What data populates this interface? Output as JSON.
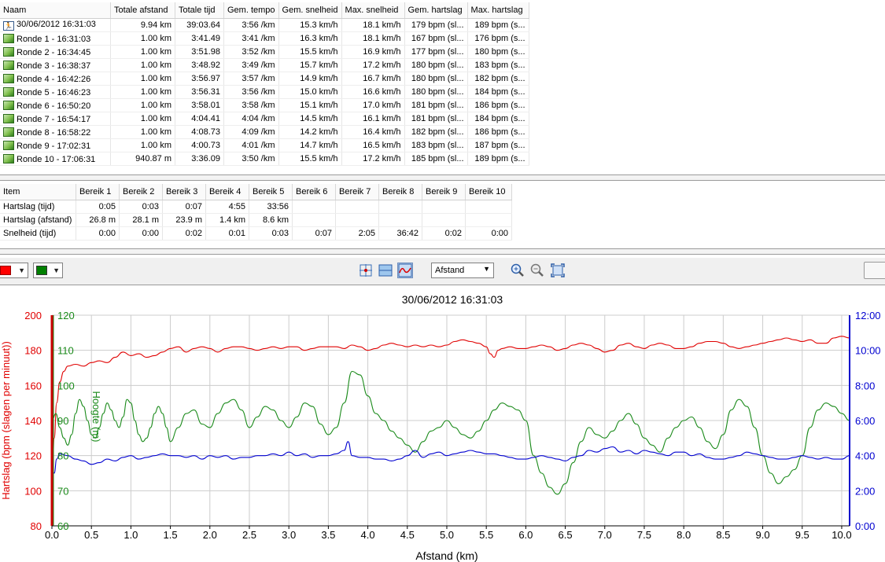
{
  "laps": {
    "columns": [
      "Naam",
      "Totale afstand",
      "Totale tijd",
      "Gem. tempo",
      "Gem. snelheid",
      "Max. snelheid",
      "Gem. hartslag",
      "Max. hartslag"
    ],
    "rows": [
      {
        "name": "30/06/2012 16:31:03",
        "icon": "run-icon",
        "dist": "9.94 km",
        "time": "39:03.64",
        "pace": "3:56 /km",
        "avg_speed": "15.3 km/h",
        "max_speed": "18.1 km/h",
        "avg_hr": "179 bpm (sl...",
        "max_hr": "189 bpm (s..."
      },
      {
        "name": "Ronde 1 - 16:31:03",
        "icon": "lap-icon",
        "dist": "1.00 km",
        "time": "3:41.49",
        "pace": "3:41 /km",
        "avg_speed": "16.3 km/h",
        "max_speed": "18.1 km/h",
        "avg_hr": "167 bpm (sl...",
        "max_hr": "176 bpm (s..."
      },
      {
        "name": "Ronde 2 - 16:34:45",
        "icon": "lap-icon",
        "dist": "1.00 km",
        "time": "3:51.98",
        "pace": "3:52 /km",
        "avg_speed": "15.5 km/h",
        "max_speed": "16.9 km/h",
        "avg_hr": "177 bpm (sl...",
        "max_hr": "180 bpm (s..."
      },
      {
        "name": "Ronde 3 - 16:38:37",
        "icon": "lap-icon",
        "dist": "1.00 km",
        "time": "3:48.92",
        "pace": "3:49 /km",
        "avg_speed": "15.7 km/h",
        "max_speed": "17.2 km/h",
        "avg_hr": "180 bpm (sl...",
        "max_hr": "183 bpm (s..."
      },
      {
        "name": "Ronde 4 - 16:42:26",
        "icon": "lap-icon",
        "dist": "1.00 km",
        "time": "3:56.97",
        "pace": "3:57 /km",
        "avg_speed": "14.9 km/h",
        "max_speed": "16.7 km/h",
        "avg_hr": "180 bpm (sl...",
        "max_hr": "182 bpm (s..."
      },
      {
        "name": "Ronde 5 - 16:46:23",
        "icon": "lap-icon",
        "dist": "1.00 km",
        "time": "3:56.31",
        "pace": "3:56 /km",
        "avg_speed": "15.0 km/h",
        "max_speed": "16.6 km/h",
        "avg_hr": "180 bpm (sl...",
        "max_hr": "184 bpm (s..."
      },
      {
        "name": "Ronde 6 - 16:50:20",
        "icon": "lap-icon",
        "dist": "1.00 km",
        "time": "3:58.01",
        "pace": "3:58 /km",
        "avg_speed": "15.1 km/h",
        "max_speed": "17.0 km/h",
        "avg_hr": "181 bpm (sl...",
        "max_hr": "186 bpm (s..."
      },
      {
        "name": "Ronde 7 - 16:54:17",
        "icon": "lap-icon",
        "dist": "1.00 km",
        "time": "4:04.41",
        "pace": "4:04 /km",
        "avg_speed": "14.5 km/h",
        "max_speed": "16.1 km/h",
        "avg_hr": "181 bpm (sl...",
        "max_hr": "184 bpm (s..."
      },
      {
        "name": "Ronde 8 - 16:58:22",
        "icon": "lap-icon",
        "dist": "1.00 km",
        "time": "4:08.73",
        "pace": "4:09 /km",
        "avg_speed": "14.2 km/h",
        "max_speed": "16.4 km/h",
        "avg_hr": "182 bpm (sl...",
        "max_hr": "186 bpm (s..."
      },
      {
        "name": "Ronde 9 - 17:02:31",
        "icon": "lap-icon",
        "dist": "1.00 km",
        "time": "4:00.73",
        "pace": "4:01 /km",
        "avg_speed": "14.7 km/h",
        "max_speed": "16.5 km/h",
        "avg_hr": "183 bpm (sl...",
        "max_hr": "187 bpm (s..."
      },
      {
        "name": "Ronde 10 - 17:06:31",
        "icon": "lap-icon",
        "dist": "940.87 m",
        "time": "3:36.09",
        "pace": "3:50 /km",
        "avg_speed": "15.5 km/h",
        "max_speed": "17.2 km/h",
        "avg_hr": "185 bpm (sl...",
        "max_hr": "189 bpm (s..."
      }
    ]
  },
  "zones": {
    "columns": [
      "Item",
      "Bereik 1",
      "Bereik 2",
      "Bereik 3",
      "Bereik 4",
      "Bereik 5",
      "Bereik 6",
      "Bereik 7",
      "Bereik 8",
      "Bereik 9",
      "Bereik 10"
    ],
    "rows": [
      {
        "label": "Hartslag (tijd)",
        "values": [
          "0:05",
          "0:03",
          "0:07",
          "4:55",
          "33:56",
          "",
          "",
          "",
          "",
          ""
        ]
      },
      {
        "label": "Hartslag (afstand)",
        "values": [
          "26.8 m",
          "28.1 m",
          "23.9 m",
          "1.4 km",
          "8.6 km",
          "",
          "",
          "",
          "",
          ""
        ]
      },
      {
        "label": "Snelheid (tijd)",
        "values": [
          "0:00",
          "0:00",
          "0:02",
          "0:01",
          "0:03",
          "0:07",
          "2:05",
          "36:42",
          "0:02",
          "0:00"
        ]
      }
    ]
  },
  "toolbar": {
    "color1": "#ff0000",
    "color2": "#008000",
    "x_axis_select": "Afstand"
  },
  "chart_data": {
    "type": "line",
    "title": "30/06/2012 16:31:03",
    "xlabel": "Afstand (km)",
    "xlim": [
      0,
      10.1
    ],
    "x_ticks": [
      "0.0",
      "0.5",
      "1.0",
      "1.5",
      "2.0",
      "2.5",
      "3.0",
      "3.5",
      "4.0",
      "4.5",
      "5.0",
      "5.5",
      "6.0",
      "6.5",
      "7.0",
      "7.5",
      "8.0",
      "8.5",
      "9.0",
      "9.5",
      "10.0"
    ],
    "grid": true,
    "axes": {
      "hr": {
        "label": "Hartslag (bpm (slagen per minuut))",
        "ylim": [
          80,
          200
        ],
        "ticks": [
          "80",
          "100",
          "120",
          "140",
          "160",
          "180",
          "200"
        ],
        "color": "#e00000"
      },
      "alt": {
        "label": "Hoogte (m)",
        "ylim": [
          60,
          120
        ],
        "ticks": [
          "60",
          "70",
          "80",
          "90",
          "100",
          "110",
          "120"
        ],
        "color": "#1a8a1a"
      },
      "speed": {
        "label": "",
        "ylim": [
          0,
          12
        ],
        "ticks": [
          "0:00",
          "2:00",
          "4:00",
          "6:00",
          "8:00",
          "10:00",
          "12:00"
        ],
        "color": "#0000d0"
      }
    },
    "series": [
      {
        "axis": "hr",
        "x": [
          0,
          0.03,
          0.06,
          0.1,
          0.15,
          0.2,
          0.3,
          0.4,
          0.5,
          0.6,
          0.7,
          0.8,
          0.9,
          1.0,
          1.1,
          1.2,
          1.3,
          1.4,
          1.5,
          1.6,
          1.7,
          1.8,
          1.9,
          2.0,
          2.1,
          2.2,
          2.3,
          2.4,
          2.5,
          2.6,
          2.7,
          2.8,
          2.9,
          3.0,
          3.1,
          3.2,
          3.3,
          3.4,
          3.5,
          3.6,
          3.7,
          3.8,
          3.9,
          4.0,
          4.1,
          4.2,
          4.3,
          4.4,
          4.5,
          4.6,
          4.7,
          4.8,
          4.9,
          5.0,
          5.1,
          5.2,
          5.3,
          5.4,
          5.5,
          5.55,
          5.6,
          5.65,
          5.7,
          5.8,
          5.9,
          6.0,
          6.1,
          6.2,
          6.3,
          6.4,
          6.5,
          6.6,
          6.7,
          6.8,
          6.9,
          7.0,
          7.1,
          7.2,
          7.3,
          7.4,
          7.5,
          7.6,
          7.7,
          7.8,
          7.9,
          8.0,
          8.1,
          8.2,
          8.3,
          8.4,
          8.5,
          8.6,
          8.7,
          8.8,
          8.9,
          9.0,
          9.1,
          9.2,
          9.3,
          9.4,
          9.5,
          9.6,
          9.7,
          9.8,
          9.9,
          10.0,
          10.1
        ],
        "y": [
          100,
          130,
          150,
          162,
          168,
          171,
          172,
          171,
          173,
          174,
          173,
          176,
          179,
          177,
          178,
          176,
          177,
          179,
          181,
          182,
          179,
          181,
          182,
          181,
          179,
          181,
          182,
          182,
          181,
          180,
          181,
          182,
          181,
          182,
          182,
          180,
          181,
          182,
          182,
          182,
          181,
          183,
          182,
          180,
          181,
          183,
          184,
          183,
          182,
          183,
          182,
          183,
          182,
          183,
          185,
          186,
          185,
          184,
          182,
          178,
          176,
          180,
          181,
          182,
          181,
          181,
          182,
          183,
          182,
          180,
          181,
          183,
          184,
          183,
          181,
          179,
          180,
          183,
          184,
          182,
          181,
          183,
          184,
          183,
          181,
          181,
          182,
          184,
          185,
          185,
          184,
          182,
          181,
          182,
          183,
          184,
          185,
          186,
          187,
          186,
          185,
          186,
          184,
          184,
          187,
          188,
          187
        ]
      },
      {
        "axis": "alt",
        "x": [
          0,
          0.05,
          0.1,
          0.15,
          0.2,
          0.25,
          0.3,
          0.35,
          0.4,
          0.45,
          0.5,
          0.55,
          0.6,
          0.65,
          0.7,
          0.75,
          0.8,
          0.85,
          0.9,
          0.95,
          1.0,
          1.05,
          1.1,
          1.15,
          1.2,
          1.25,
          1.3,
          1.35,
          1.4,
          1.45,
          1.5,
          1.6,
          1.7,
          1.8,
          1.9,
          2.0,
          2.1,
          2.2,
          2.3,
          2.4,
          2.5,
          2.6,
          2.7,
          2.8,
          2.9,
          3.0,
          3.1,
          3.2,
          3.3,
          3.4,
          3.5,
          3.6,
          3.7,
          3.8,
          3.9,
          4.0,
          4.1,
          4.2,
          4.3,
          4.4,
          4.5,
          4.6,
          4.7,
          4.8,
          4.9,
          5.0,
          5.1,
          5.2,
          5.3,
          5.4,
          5.5,
          5.6,
          5.7,
          5.8,
          5.9,
          6.0,
          6.1,
          6.2,
          6.3,
          6.4,
          6.5,
          6.6,
          6.7,
          6.8,
          6.9,
          7.0,
          7.1,
          7.2,
          7.3,
          7.4,
          7.5,
          7.6,
          7.7,
          7.8,
          7.9,
          8.0,
          8.1,
          8.2,
          8.3,
          8.4,
          8.5,
          8.6,
          8.7,
          8.8,
          8.9,
          9.0,
          9.1,
          9.2,
          9.3,
          9.4,
          9.5,
          9.6,
          9.7,
          9.8,
          9.9,
          10.0,
          10.1
        ],
        "y": [
          90,
          92,
          88,
          85,
          83,
          86,
          92,
          96,
          94,
          90,
          86,
          85,
          88,
          92,
          95,
          93,
          90,
          88,
          91,
          96,
          95,
          90,
          86,
          84,
          85,
          88,
          92,
          94,
          92,
          88,
          84,
          88,
          92,
          93,
          89,
          88,
          92,
          95,
          96,
          93,
          88,
          91,
          94,
          93,
          90,
          88,
          91,
          95,
          94,
          89,
          86,
          88,
          95,
          104,
          103,
          97,
          92,
          90,
          87,
          85,
          83,
          81,
          84,
          87,
          88,
          90,
          88,
          86,
          85,
          87,
          90,
          93,
          95,
          94,
          93,
          90,
          80,
          75,
          71,
          69,
          72,
          78,
          84,
          88,
          86,
          85,
          87,
          90,
          92,
          89,
          85,
          83,
          81,
          85,
          88,
          90,
          91,
          88,
          84,
          82,
          86,
          93,
          96,
          94,
          88,
          80,
          75,
          72,
          74,
          76,
          80,
          88,
          93,
          95,
          94,
          92,
          90
        ]
      },
      {
        "axis": "speed",
        "x": [
          0,
          0.03,
          0.06,
          0.1,
          0.2,
          0.3,
          0.4,
          0.5,
          0.6,
          0.7,
          0.8,
          0.9,
          1.0,
          1.1,
          1.2,
          1.3,
          1.4,
          1.5,
          1.6,
          1.7,
          1.8,
          1.9,
          2.0,
          2.1,
          2.2,
          2.3,
          2.4,
          2.5,
          2.6,
          2.7,
          2.8,
          2.9,
          3.0,
          3.1,
          3.2,
          3.3,
          3.4,
          3.5,
          3.6,
          3.7,
          3.75,
          3.8,
          3.9,
          4.0,
          4.1,
          4.2,
          4.3,
          4.4,
          4.5,
          4.6,
          4.7,
          4.8,
          4.9,
          5.0,
          5.1,
          5.2,
          5.3,
          5.4,
          5.5,
          5.6,
          5.7,
          5.8,
          5.9,
          6.0,
          6.1,
          6.2,
          6.3,
          6.4,
          6.5,
          6.6,
          6.7,
          6.8,
          6.9,
          7.0,
          7.1,
          7.2,
          7.3,
          7.4,
          7.5,
          7.6,
          7.7,
          7.8,
          7.9,
          8.0,
          8.1,
          8.2,
          8.3,
          8.4,
          8.5,
          8.6,
          8.7,
          8.8,
          8.9,
          9.0,
          9.1,
          9.2,
          9.3,
          9.4,
          9.5,
          9.6,
          9.7,
          9.8,
          9.9,
          10.0,
          10.1
        ],
        "y": [
          3.3,
          3.0,
          3.8,
          4.1,
          4.0,
          3.8,
          3.7,
          3.5,
          3.6,
          3.8,
          3.7,
          3.9,
          4.0,
          3.8,
          3.9,
          4.0,
          4.1,
          4.0,
          4.0,
          3.9,
          4.0,
          3.8,
          4.0,
          3.9,
          4.0,
          3.8,
          3.9,
          3.9,
          4.0,
          4.0,
          4.1,
          4.0,
          4.2,
          4.0,
          4.1,
          3.9,
          4.0,
          4.0,
          4.1,
          4.3,
          4.8,
          4.0,
          3.9,
          3.9,
          3.8,
          3.8,
          3.7,
          3.8,
          4.0,
          4.3,
          3.9,
          4.1,
          4.2,
          4.0,
          4.1,
          4.2,
          4.3,
          4.2,
          4.1,
          4.1,
          4.0,
          3.9,
          3.8,
          3.8,
          3.9,
          4.0,
          3.9,
          3.8,
          3.7,
          3.9,
          4.0,
          4.3,
          4.2,
          4.4,
          4.5,
          4.2,
          4.3,
          4.1,
          4.3,
          4.2,
          4.1,
          4.0,
          4.2,
          4.2,
          4.0,
          4.1,
          3.9,
          3.8,
          3.8,
          3.9,
          4.0,
          4.2,
          4.1,
          4.0,
          3.9,
          3.8,
          3.8,
          3.9,
          4.0,
          3.9,
          3.8,
          3.9,
          3.8,
          3.8,
          4.0
        ]
      }
    ]
  }
}
